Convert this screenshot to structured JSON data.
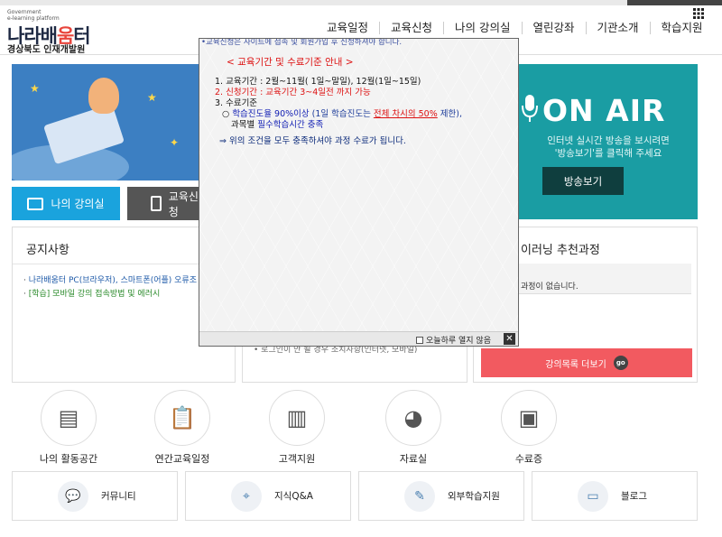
{
  "header": {
    "logo_small": "Government\ne-learning platform",
    "logo_main_1": "나라배",
    "logo_main_2": "움",
    "logo_main_3": "터",
    "org": "경상북도 인재개발원",
    "nav": [
      "교육일정",
      "교육신청",
      "나의 강의실",
      "열린강좌",
      "기관소개",
      "학습지원"
    ],
    "menu_icon": "grid-icon"
  },
  "buttons": {
    "my_classroom": "나의 강의실",
    "apply": "교육신청"
  },
  "onair": {
    "title": "ON AIR",
    "desc_1": "인터넷 실시간 방송을 보시려면",
    "desc_2": "'방송보기'를 클릭해 주세요",
    "button": "방송보기"
  },
  "notice": {
    "title": "공지사항",
    "items": [
      {
        "text": "나라배움터 PC(브라우저), 스마트폰(어플) 오류조",
        "color": "blue"
      },
      {
        "text": "[학습] 모바일 강의 접속방법 및 에러시",
        "color": "green"
      }
    ]
  },
  "mid_panel": {
    "item": "로그인이 안 될 경우 조치사항(인터넷, 모바일)"
  },
  "recommend": {
    "title": "이러닝 추천과정",
    "empty": "과정이 없습니다.",
    "more": "강의목록 더보기",
    "go": "go"
  },
  "quick_links": [
    {
      "label": "나의 활동공간",
      "icon": "book-icon"
    },
    {
      "label": "연간교육일정",
      "icon": "clipboard-icon"
    },
    {
      "label": "고객지원",
      "icon": "chart-icon"
    },
    {
      "label": "자료실",
      "icon": "pie-chart-icon"
    },
    {
      "label": "수료증",
      "icon": "id-card-icon"
    }
  ],
  "bottom_links": [
    {
      "label": "커뮤니티",
      "icon": "chat-icon"
    },
    {
      "label": "지식Q&A",
      "icon": "map-pin-icon"
    },
    {
      "label": "외부학습지원",
      "icon": "document-icon"
    },
    {
      "label": "블로그",
      "icon": "monitor-icon"
    }
  ],
  "popup": {
    "top_line": "•교육신청은 사이트에 접속 및 회원가입 후 신청하셔야 합니다.",
    "heading": "< 교육기간 및 수료기준 안내 >",
    "line1": "1. 교육기간 : 2월~11월( 1일~말일), 12월(1일~15일)",
    "line2": "2. 신청기간 : 교육기간 3~4일전 까지 가능",
    "line3": "3. 수료기준",
    "line4a": "○ ",
    "line4b": "학습진도율 90%이상",
    "line4c": " (1일 학습진도는 ",
    "line4d": "전체 차시의 50%",
    "line4e": " 제한),",
    "line5a": "과목별 ",
    "line5b": "필수학습시간 충족",
    "note": "⇒ 위의 조건을 모두 충족하셔야 과정 수료가 됩니다.",
    "dont_show": "오늘하루 열지 않음",
    "close": "✕"
  }
}
